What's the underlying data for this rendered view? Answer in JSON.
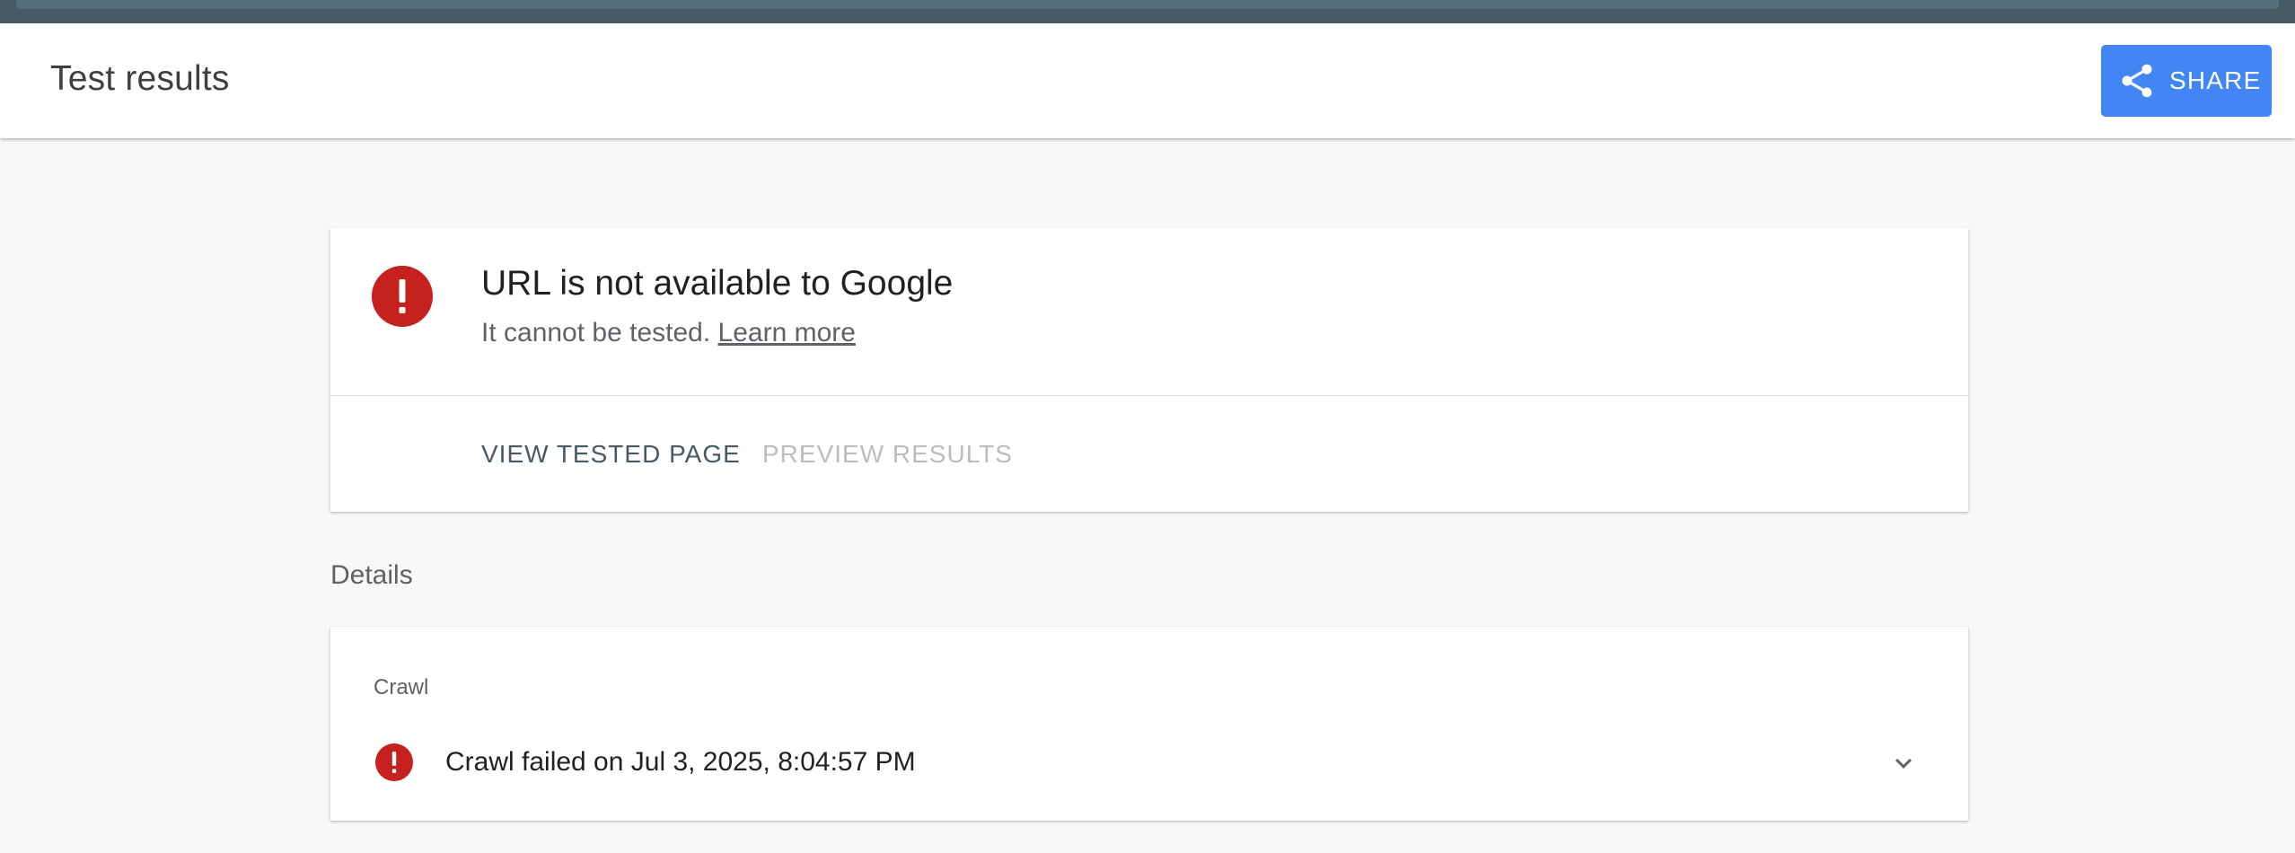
{
  "header": {
    "title": "Test results",
    "share_label": "SHARE",
    "share_icon": "share-icon"
  },
  "result": {
    "icon": "error-icon",
    "title": "URL is not available to Google",
    "subtitle": "It cannot be tested.",
    "learn_more": "Learn more",
    "actions": {
      "view_tested_page": "VIEW TESTED PAGE",
      "preview_results": "PREVIEW RESULTS"
    }
  },
  "details": {
    "heading": "Details",
    "crawl": {
      "label": "Crawl",
      "status": "Crawl failed on Jul 3, 2025, 8:04:57 PM",
      "icon": "error-icon",
      "expand_icon": "chevron-down-icon"
    }
  },
  "colors": {
    "accent": "#4285f4",
    "error": "#c5221f",
    "top_bar": "#455a64",
    "disabled": "#bdbdbd"
  }
}
